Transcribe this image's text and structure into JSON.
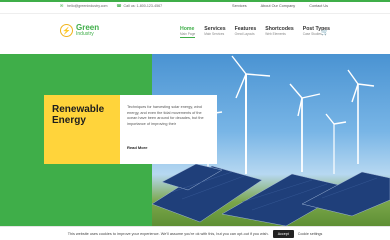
{
  "topbar": {
    "email": "hello@greenindustry.com",
    "phone": "Call us: 1-800-123-4567",
    "links": [
      "Services",
      "About Our Company",
      "Contact Us"
    ]
  },
  "logo": {
    "line1": "Green",
    "line2": "Industry"
  },
  "nav": [
    {
      "title": "Home",
      "sub": "Main Page"
    },
    {
      "title": "Services",
      "sub": "Main Services"
    },
    {
      "title": "Features",
      "sub": "Great Layouts"
    },
    {
      "title": "Shortcodes",
      "sub": "Web Elements"
    },
    {
      "title": "Post Types",
      "sub": "Case Studies"
    }
  ],
  "hero": {
    "title": "Renewable Energy",
    "description": "Techniques for harvesting solar energy, wind energy, and even the tidal movements of the ocean have been around for decades, but the importance of improving their",
    "read_more": "Read More"
  },
  "cookie": {
    "message": "This website uses cookies to improve your experience. We'll assume you're ok with this, but you can opt-out if you wish.",
    "accept": "Accept",
    "settings": "Cookie settings"
  },
  "colors": {
    "brand_green": "#3fae49",
    "accent_yellow": "#ffd43b"
  }
}
